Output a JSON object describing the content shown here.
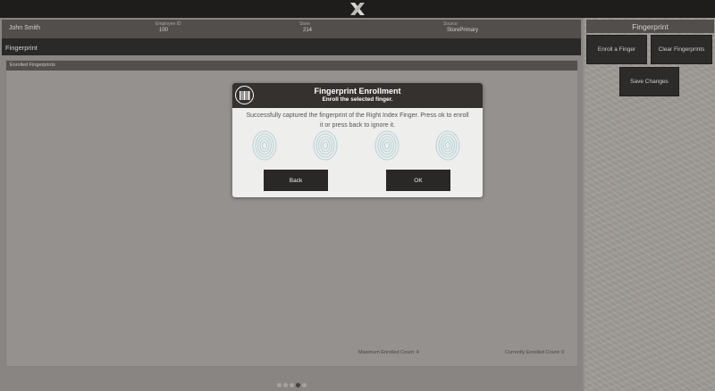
{
  "topbar": {
    "logo_icon": "x-logo-icon"
  },
  "info": {
    "name": "John Smith",
    "employee_id_label": "Employee ID",
    "employee_id": "100",
    "store_label": "Store",
    "store": "214",
    "source_label": "Source",
    "source": "StorePrimary"
  },
  "page_title": "Fingerprint",
  "enrolled": {
    "header": "Enrolled Fingerprints",
    "max_count": "Maximum Enrolled Count: 4",
    "current_count": "Currently Enrolled Count: 0"
  },
  "pager": {
    "total": 5,
    "active": 4
  },
  "right_panel": {
    "title": "Fingerprint",
    "enroll_button": "Enroll a Finger",
    "clear_button": "Clear Fingerprints",
    "save_button": "Save Changes"
  },
  "dialog": {
    "icon": "barcode-icon",
    "title": "Fingerprint Enrollment",
    "subtitle": "Enroll the selected finger.",
    "message": "Successfully captured the fingerprint of the Right Index Finger. Press ok to enroll it or press back to ignore it.",
    "fingerprint_icon": "fingerprint-icon",
    "back_button": "Back",
    "ok_button": "OK"
  },
  "colors": {
    "topbar": "#1e1d1c",
    "header_strip": "#4c4946",
    "button": "#1f1e1d",
    "dialog_header": "#35312e",
    "fingerprint": "#b7d3d9"
  }
}
